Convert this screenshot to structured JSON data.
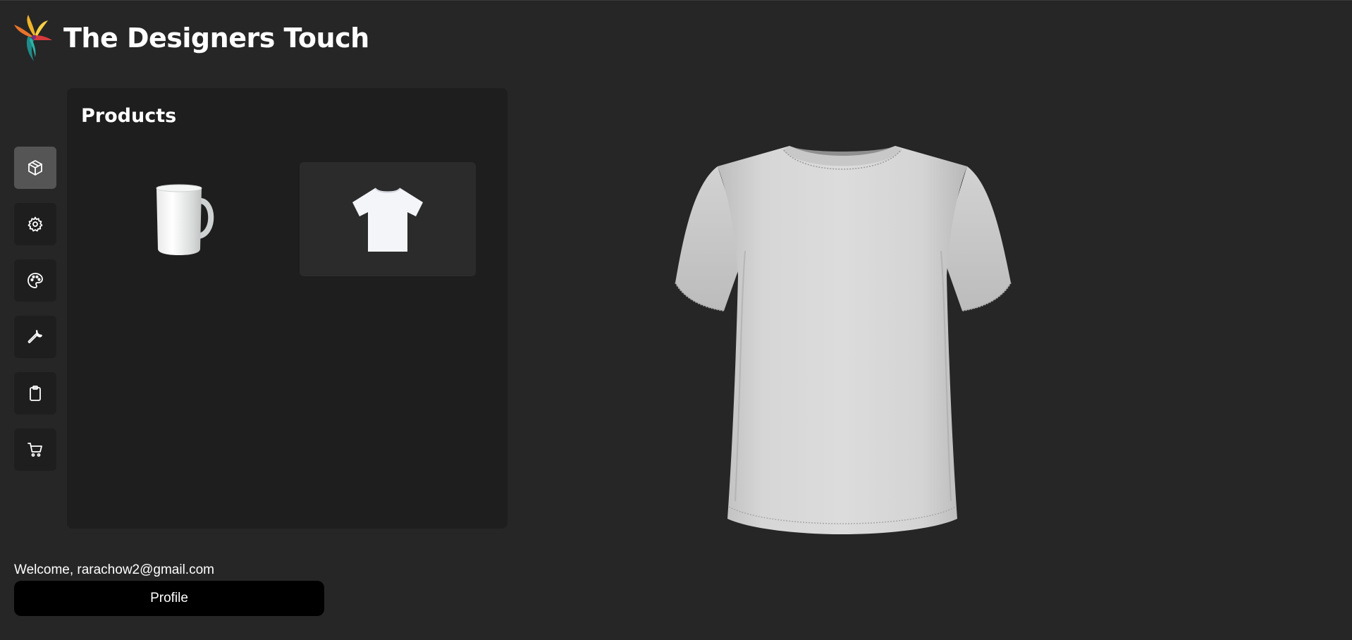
{
  "app": {
    "title": "The Designers Touch"
  },
  "sidebar": {
    "items": [
      {
        "icon": "box-icon",
        "active": true
      },
      {
        "icon": "gear-icon",
        "active": false
      },
      {
        "icon": "palette-icon",
        "active": false
      },
      {
        "icon": "wrench-icon",
        "active": false
      },
      {
        "icon": "clipboard-icon",
        "active": false
      },
      {
        "icon": "cart-icon",
        "active": false
      }
    ]
  },
  "products_panel": {
    "title": "Products",
    "items": [
      {
        "image": "mug-image",
        "selected": false
      },
      {
        "image": "tshirt-image",
        "selected": true
      }
    ]
  },
  "viewer": {
    "model": "tshirt-3d-model",
    "color": "#d4d4d4"
  },
  "user": {
    "welcome_text": "Welcome, rarachow2@gmail.com",
    "profile_label": "Profile"
  }
}
